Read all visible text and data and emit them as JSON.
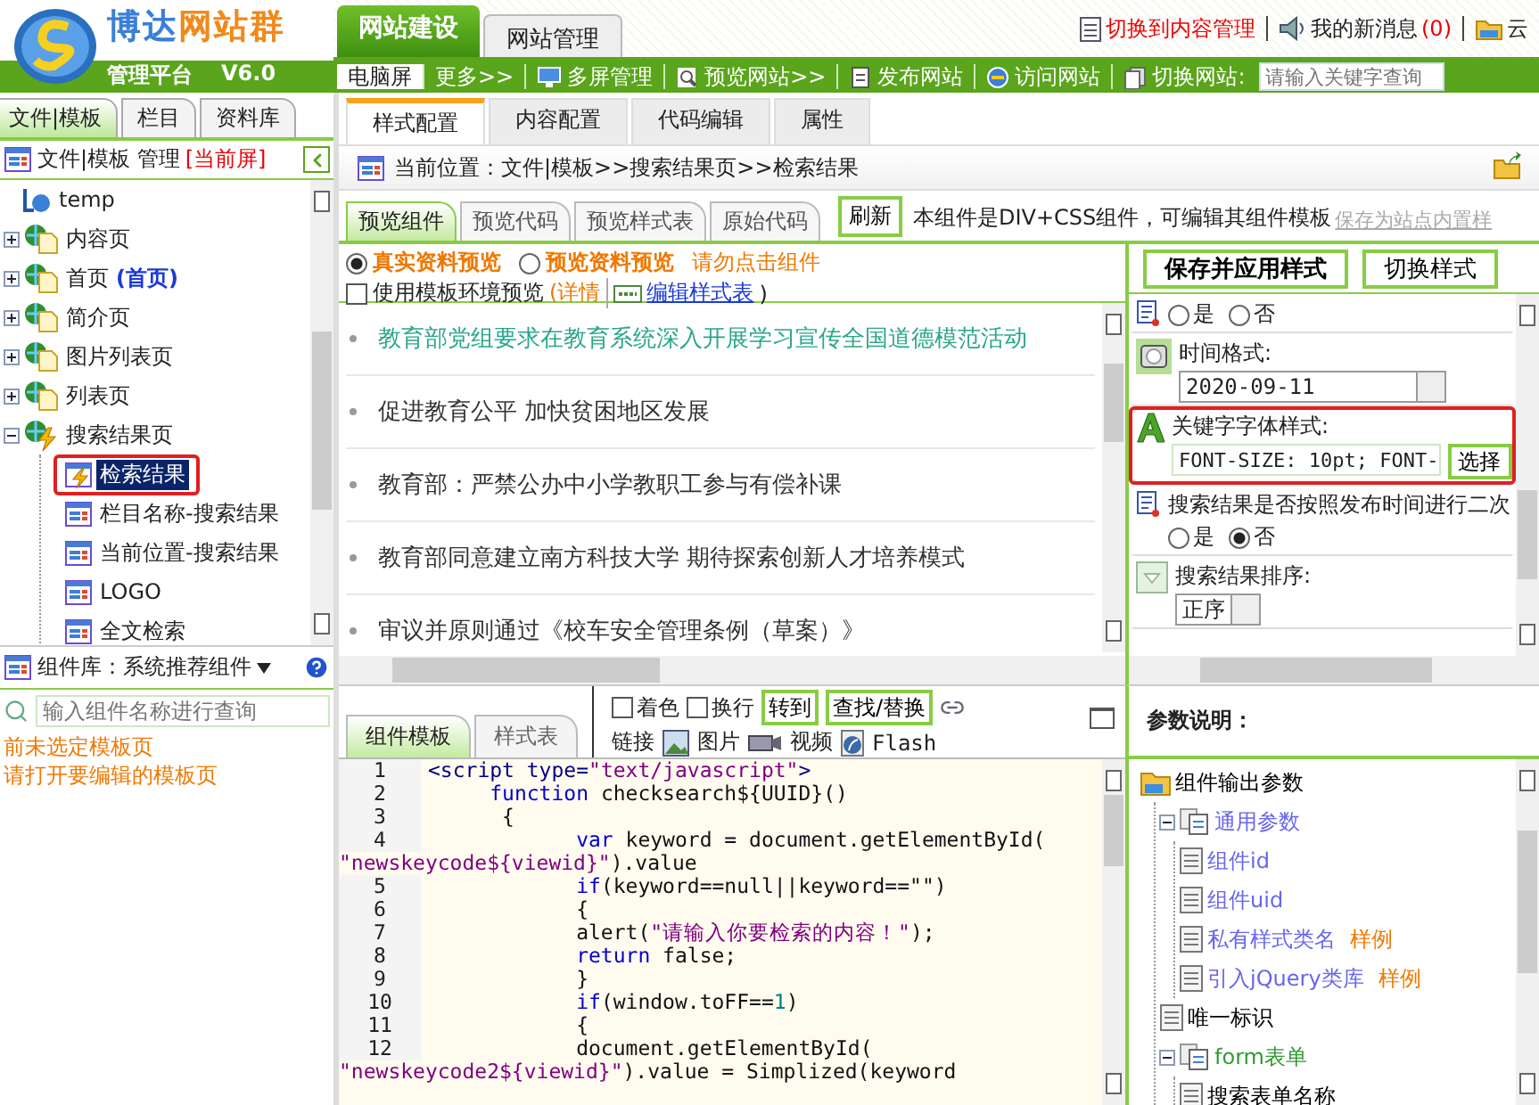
{
  "logo": {
    "title_parts": [
      {
        "text": "博达",
        "color": "#3a7fd8"
      },
      {
        "text": "网站群",
        "color": "#f08a1c"
      }
    ],
    "subtitle": "管理平台",
    "version": "V6.0"
  },
  "main_tabs": [
    {
      "label": "网站建设",
      "selected": true
    },
    {
      "label": "网站管理",
      "selected": false
    }
  ],
  "top_links": [
    {
      "kind": "switch",
      "label": "切换到内容管理"
    },
    {
      "kind": "messages",
      "label": "我的新消息",
      "count": "(0)"
    },
    {
      "kind": "cloud",
      "label": "云"
    }
  ],
  "toolbar": [
    {
      "kind": "screen",
      "label": "电脑屏",
      "selected": true
    },
    {
      "kind": "more",
      "label": "更多>>",
      "selected": false
    },
    {
      "kind": "multi",
      "label": "多屏管理",
      "selected": false
    },
    {
      "kind": "preview",
      "label": "预览网站>>",
      "selected": false
    },
    {
      "kind": "publish",
      "label": "发布网站",
      "selected": false
    },
    {
      "kind": "visit",
      "label": "访问网站",
      "selected": false
    },
    {
      "kind": "switch",
      "label": "切换网站:",
      "selected": false
    }
  ],
  "site_search": {
    "placeholder": "请输入关键字查询"
  },
  "left_tabs": [
    {
      "label": "文件|模板",
      "selected": true
    },
    {
      "label": "栏目",
      "selected": false
    },
    {
      "label": "资料库",
      "selected": false
    }
  ],
  "file_panel": {
    "title": "文件|模板 管理",
    "screen": "[当前屏]"
  },
  "file_tree": [
    {
      "label": "temp",
      "kind": "shortcut"
    },
    {
      "label": "内容页",
      "kind": "page",
      "expanded": false
    },
    {
      "label": "首页",
      "tag": "(首页)",
      "kind": "page",
      "expanded": false
    },
    {
      "label": "简介页",
      "kind": "page",
      "expanded": false
    },
    {
      "label": "图片列表页",
      "kind": "page",
      "expanded": false
    },
    {
      "label": "列表页",
      "kind": "page",
      "expanded": false
    },
    {
      "label": "搜索结果页",
      "kind": "dynamic-page",
      "expanded": true,
      "children": [
        {
          "label": "检索结果",
          "kind": "dynamic-component",
          "selected": true,
          "marked": true
        },
        {
          "label": "栏目名称-搜索结果",
          "kind": "component",
          "selected": false,
          "marked": false
        },
        {
          "label": "当前位置-搜索结果",
          "kind": "component",
          "selected": false,
          "marked": false
        },
        {
          "label": "LOGO",
          "kind": "component",
          "selected": false,
          "marked": false
        },
        {
          "label": "全文检索",
          "kind": "component",
          "selected": false,
          "marked": false
        }
      ]
    }
  ],
  "component_library": {
    "label": "组件库：系统推荐组件",
    "search_placeholder": "输入组件名称进行查询",
    "notices": [
      "前未选定模板页",
      "请打开要编辑的模板页"
    ]
  },
  "config_tabs": [
    {
      "label": "样式配置",
      "selected": true
    },
    {
      "label": "内容配置",
      "selected": false
    },
    {
      "label": "代码编辑",
      "selected": false
    },
    {
      "label": "属性",
      "selected": false
    }
  ],
  "breadcrumb": "当前位置：文件|模板>>搜索结果页>>检索结果",
  "preview_tabs": [
    {
      "label": "预览组件",
      "selected": true
    },
    {
      "label": "预览代码",
      "selected": false
    },
    {
      "label": "预览样式表",
      "selected": false
    },
    {
      "label": "原始代码",
      "selected": false
    }
  ],
  "refresh_button": "刷新",
  "component_info": "本组件是DIV+CSS组件，可编辑其组件模板",
  "save_preset_link": "保存为站点内置样",
  "preview_modes": [
    {
      "label": "真实资料预览",
      "selected": true
    },
    {
      "label": "预览资料预览",
      "selected": false
    }
  ],
  "preview_hint": "请勿点击组件",
  "template_env": {
    "label": "使用模板环境预览",
    "checked": false,
    "details_link": "(详情",
    "stylesheet_link": "编辑样式表",
    "close": ")"
  },
  "news": [
    {
      "title": "教育部党组要求在教育系统深入开展学习宣传全国道德模范活动",
      "highlighted": true
    },
    {
      "title": "促进教育公平 加快贫困地区发展",
      "highlighted": false
    },
    {
      "title": "教育部：严禁公办中小学教职工参与有偿补课",
      "highlighted": false
    },
    {
      "title": "教育部同意建立南方科技大学 期待探索创新人才培养模式",
      "highlighted": false
    },
    {
      "title": "审议并原则通过《校车安全管理条例（草案）》",
      "highlighted": false
    }
  ],
  "style_actions": [
    "保存并应用样式",
    "切换样式"
  ],
  "settings": [
    {
      "kind": "radio",
      "marked": false,
      "options": [
        {
          "label": "是",
          "selected": false
        },
        {
          "label": "否",
          "selected": false
        }
      ]
    },
    {
      "kind": "date",
      "label": "时间格式:",
      "value": "2020-09-11",
      "marked": false
    },
    {
      "kind": "style",
      "label": "关键字字体样式:",
      "value": "FONT-SIZE: 10pt; FONT-",
      "button": "选择",
      "marked": true
    },
    {
      "kind": "radio",
      "label": "搜索结果是否按照发布时间进行二次",
      "marked": false,
      "options": [
        {
          "label": "是",
          "selected": false
        },
        {
          "label": "否",
          "selected": true
        }
      ]
    },
    {
      "kind": "select",
      "label": "搜索结果排序:",
      "value": "正序",
      "marked": false
    }
  ],
  "editor_tabs": [
    {
      "label": "组件模板",
      "selected": true
    },
    {
      "label": "样式表",
      "selected": false
    }
  ],
  "editor_tools": [
    {
      "kind": "checkbox",
      "label": "着色",
      "checked": false
    },
    {
      "kind": "checkbox",
      "label": "换行",
      "checked": false
    },
    {
      "kind": "button",
      "label": "转到"
    },
    {
      "kind": "button",
      "label": "查找/替换"
    },
    {
      "kind": "link",
      "label": "链接"
    },
    {
      "kind": "image",
      "label": "图片"
    },
    {
      "kind": "video",
      "label": "视频"
    },
    {
      "kind": "flash",
      "label": "Flash"
    }
  ],
  "code": [
    {
      "number": "1",
      "rows": [
        [
          {
            "kind": "tag",
            "text": "<script type="
          },
          {
            "kind": "str",
            "text": "\"text/javascript\""
          },
          {
            "kind": "tag",
            "text": ">"
          }
        ]
      ]
    },
    {
      "number": "2",
      "rows": [
        [
          {
            "kind": "kw",
            "text": "     function"
          },
          {
            "kind": "plain",
            "text": " checksearch${UUID}()"
          }
        ]
      ]
    },
    {
      "number": "3",
      "rows": [
        [
          {
            "kind": "plain",
            "text": "      {"
          }
        ]
      ]
    },
    {
      "number": "4",
      "rows": [
        [
          {
            "kind": "kw",
            "text": "            var"
          },
          {
            "kind": "plain",
            "text": " keyword = document.getElementById("
          }
        ],
        [
          {
            "kind": "str",
            "text": "\"newskeycode${viewid}\""
          },
          {
            "kind": "plain",
            "text": ").value"
          }
        ]
      ]
    },
    {
      "number": "5",
      "rows": [
        [
          {
            "kind": "kw",
            "text": "            if"
          },
          {
            "kind": "plain",
            "text": "(keyword==null||keyword==\"\")"
          }
        ]
      ]
    },
    {
      "number": "6",
      "rows": [
        [
          {
            "kind": "plain",
            "text": "            {"
          }
        ]
      ]
    },
    {
      "number": "7",
      "rows": [
        [
          {
            "kind": "plain",
            "text": "            alert("
          },
          {
            "kind": "str",
            "text": "\"请输入你要检索的内容！\""
          },
          {
            "kind": "plain",
            "text": ");"
          }
        ]
      ]
    },
    {
      "number": "8",
      "rows": [
        [
          {
            "kind": "kw",
            "text": "            return"
          },
          {
            "kind": "plain",
            "text": " false;"
          }
        ]
      ]
    },
    {
      "number": "9",
      "rows": [
        [
          {
            "kind": "plain",
            "text": "            }"
          }
        ]
      ]
    },
    {
      "number": "10",
      "rows": [
        [
          {
            "kind": "kw",
            "text": "            if"
          },
          {
            "kind": "plain",
            "text": "(window.toFF=="
          },
          {
            "kind": "num",
            "text": "1"
          },
          {
            "kind": "plain",
            "text": ")"
          }
        ]
      ]
    },
    {
      "number": "11",
      "rows": [
        [
          {
            "kind": "plain",
            "text": "            {"
          }
        ]
      ]
    },
    {
      "number": "12",
      "rows": [
        [
          {
            "kind": "plain",
            "text": "            document.getElementById("
          }
        ],
        [
          {
            "kind": "str",
            "text": "\"newskeycode2${viewid}\""
          },
          {
            "kind": "plain",
            "text": ").value = Simplized(keyword"
          }
        ]
      ]
    }
  ],
  "params": {
    "title": "参数说明：",
    "tree": [
      {
        "label": "组件输出参数",
        "kind": "folder",
        "color": "#000000",
        "children": [
          {
            "label": "通用参数",
            "kind": "group",
            "expanded": true,
            "color": "#6666ee",
            "children": [
              {
                "label": "组件id",
                "kind": "param",
                "color": "#6666ee"
              },
              {
                "label": "组件uid",
                "kind": "param",
                "color": "#6666ee"
              },
              {
                "label": "私有样式类名",
                "tag": "样例",
                "kind": "param",
                "color": "#6666ee"
              },
              {
                "label": "引入jQuery类库",
                "tag": "样例",
                "kind": "param",
                "color": "#6666ee"
              }
            ]
          },
          {
            "label": "唯一标识",
            "kind": "param",
            "color": "#000000"
          },
          {
            "label": "form表单",
            "kind": "group",
            "expanded": true,
            "color": "#339933",
            "children": [
              {
                "label": "搜索表单名称",
                "kind": "param",
                "color": "#000000"
              }
            ]
          }
        ]
      }
    ]
  }
}
